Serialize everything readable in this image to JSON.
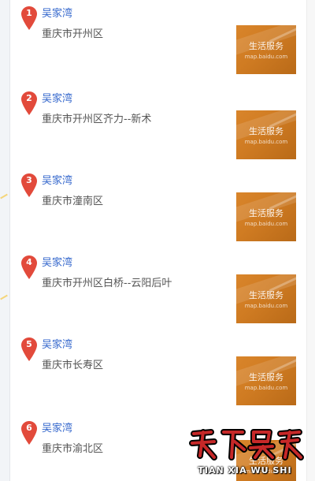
{
  "results": [
    {
      "index": "1",
      "name": "吴家湾",
      "address": "重庆市开州区",
      "thumb_text": "生活服务",
      "thumb_sub": "map.baidu.com"
    },
    {
      "index": "2",
      "name": "吴家湾",
      "address": "重庆市开州区齐力--新术",
      "thumb_text": "生活服务",
      "thumb_sub": "map.baidu.com"
    },
    {
      "index": "3",
      "name": "吴家湾",
      "address": "重庆市潼南区",
      "thumb_text": "生活服务",
      "thumb_sub": "map.baidu.com"
    },
    {
      "index": "4",
      "name": "吴家湾",
      "address": "重庆市开州区白桥--云阳后叶",
      "thumb_text": "生活服务",
      "thumb_sub": "map.baidu.com"
    },
    {
      "index": "5",
      "name": "吴家湾",
      "address": "重庆市长寿区",
      "thumb_text": "生活服务",
      "thumb_sub": "map.baidu.com"
    },
    {
      "index": "6",
      "name": "吴家湾",
      "address": "重庆市渝北区",
      "thumb_text": "生活服务",
      "thumb_sub": "map.baidu.com"
    }
  ],
  "watermark": {
    "logo_text": "天下吴氏",
    "text": "TIAN XIA WU SHI"
  },
  "colors": {
    "marker": "#e24a3b",
    "title": "#3366cc",
    "address": "#555555",
    "thumb": "#d9852b",
    "watermark_logo": "#c62828"
  }
}
